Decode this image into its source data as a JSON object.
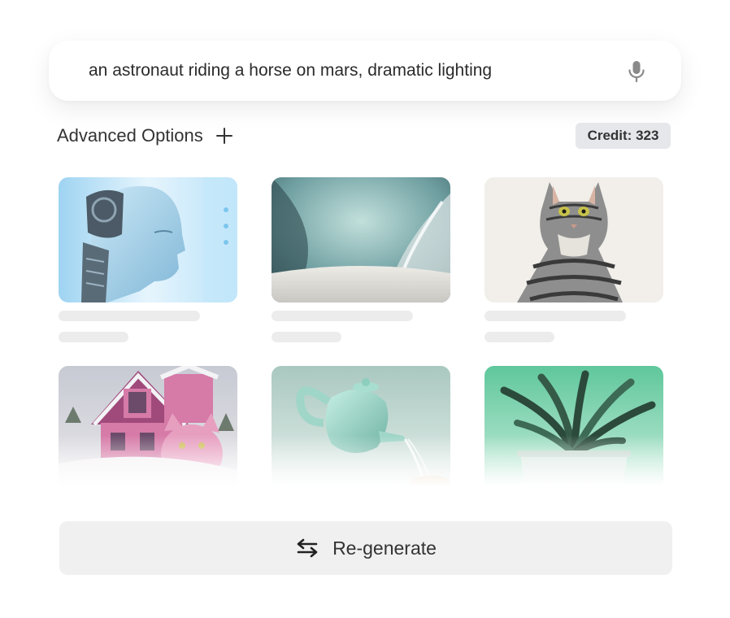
{
  "prompt": {
    "text": "an astronaut riding a horse on mars, dramatic lighting",
    "mic_icon": "microphone-icon"
  },
  "options": {
    "label": "Advanced Options",
    "expand_icon": "plus-icon"
  },
  "credit": {
    "label": "Credit: 323"
  },
  "gallery": {
    "items": [
      {
        "subject": "humanoid robot head",
        "status": "loading"
      },
      {
        "subject": "abstract teal curved interior",
        "status": "loading"
      },
      {
        "subject": "grey tabby cat",
        "status": "loading"
      },
      {
        "subject": "pink house with pink cat in snow",
        "status": "loading"
      },
      {
        "subject": "mint watering can pouring water",
        "status": "loading"
      },
      {
        "subject": "green potted plant",
        "status": "loading"
      }
    ]
  },
  "regenerate": {
    "label": "Re-generate",
    "icon": "swap-arrows-icon"
  }
}
